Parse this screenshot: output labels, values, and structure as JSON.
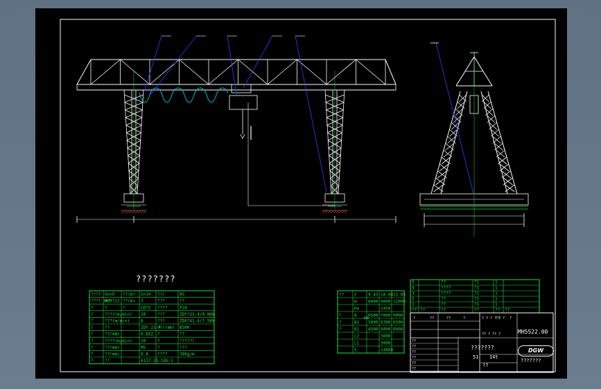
{
  "drawing": {
    "title": "???????",
    "drawing_code": "MH5522.00",
    "company_logo": "DGW",
    "company_name": "???????",
    "product_name": "???????",
    "scale": "51",
    "weight": "14t",
    "footer_label": "??",
    "colors": {
      "background": "#000000",
      "frame": "#ffffff",
      "crane": "#ffffff",
      "table": "#20e040",
      "highlight": "#00bcd4",
      "leader": "#3040ff"
    }
  },
  "param_table": {
    "rows": [
      [
        "????",
        "Gn=5",
        "??(m)",
        "S=14",
        "???",
        "A5"
      ],
      [
        "???? (m)",
        "6?9?12",
        "??(m)",
        "3",
        "???",
        "??"
      ],
      [
        "?",
        "?",
        "?",
        "CD?5",
        "????",
        "P24"
      ],
      [
        "?",
        "????(m/min)",
        "",
        "20",
        "???",
        "ZDY?21-4/0.8KW"
      ],
      [
        "?",
        "???(m/min)",
        "",
        "8",
        "???",
        "ZDX?41-4/7.5KW"
      ],
      [
        "?",
        "??",
        "",
        "ZDY 21-4",
        "???(mm)",
        "Ø300"
      ],
      [
        "?",
        "??(kW)",
        "",
        "0.8X2",
        "?",
        "??",
        "3"
      ],
      [
        "?",
        "????(m/min)",
        "",
        "20",
        "?",
        "???(?)",
        "380"
      ],
      [
        "?",
        "??(mm)",
        "",
        "M5",
        "?",
        "???",
        "S8"
      ],
      [
        "?",
        "??(mm)",
        "",
        "0.8",
        "????",
        "38kg/m"
      ],
      [
        "?",
        "??",
        "",
        "6137-15-185-1",
        "",
        ""
      ]
    ]
  },
  "dim_table": {
    "header": [
      "??",
      "t",
      "9.43",
      "10.68",
      "12.05"
    ],
    "rows": [
      [
        "",
        "H",
        "6000",
        "9000",
        "12000"
      ],
      [
        "",
        "Hx",
        "",
        "1450",
        ""
      ],
      [
        "?",
        "A",
        "9500",
        "7000",
        "9000"
      ],
      [
        "?",
        "B2",
        "5000",
        "6300",
        "6500"
      ],
      [
        "?",
        "B1",
        "4500",
        "6000",
        "8000"
      ],
      [
        "",
        "L2",
        "",
        "3000",
        ""
      ],
      [
        "",
        "L1",
        "",
        "3000",
        ""
      ],
      [
        "",
        "S",
        "",
        "14000",
        ""
      ]
    ],
    "unit": "mm"
  },
  "parts_list": {
    "rows": [
      [
        "5",
        "",
        "??",
        "?1",
        "1",
        ""
      ],
      [
        "4",
        "",
        "????",
        "?1",
        "1",
        ""
      ],
      [
        "3",
        "",
        "????",
        "?1",
        "1",
        ""
      ],
      [
        "2",
        "",
        "??",
        "?1",
        "1",
        ""
      ],
      [
        "1",
        "",
        "??",
        "?1",
        "1",
        ""
      ],
      [
        "??",
        "??",
        "??",
        "??",
        "??",
        "??"
      ]
    ]
  },
  "title_block": {
    "rev_labels": [
      "?",
      "??",
      "??",
      "?"
    ],
    "stage_labels": [
      "? ? ? ? ? ?",
      "??",
      "?"
    ],
    "signatures": [
      "??",
      "??",
      "??",
      "??",
      "??",
      "??"
    ],
    "sheet_info": "?? ? ?? ?"
  }
}
